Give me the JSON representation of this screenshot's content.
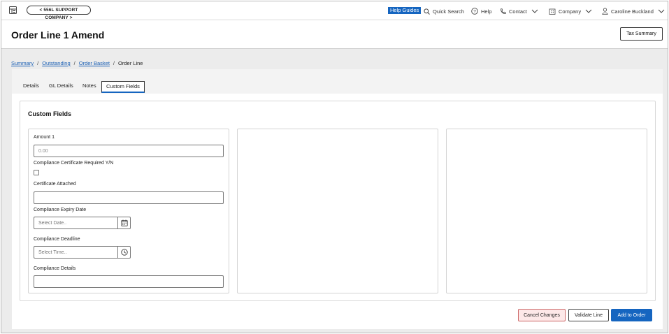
{
  "topbar": {
    "company_label": "< 556L SUPPORT COMPANY >",
    "help_guides": "Help Guides",
    "quick_search": "Quick Search",
    "help": "Help",
    "contact": "Contact",
    "company": "Company",
    "user": "Caroline Buckland"
  },
  "header": {
    "title": "Order Line 1 Amend",
    "tax_summary": "Tax Summary"
  },
  "breadcrumb": {
    "items": [
      "Summary",
      "Outstanding",
      "Order Basket"
    ],
    "current": "Order Line",
    "separator": "/"
  },
  "tabs": [
    "Details",
    "GL Details",
    "Notes",
    "Custom Fields"
  ],
  "active_tab": "Custom Fields",
  "custom_fields": {
    "title": "Custom Fields",
    "amount1_label": "Amount 1",
    "amount1_value": "0.00",
    "cert_required_label": "Compliance Certificate Required Y/N",
    "cert_attached_label": "Certificate Attached",
    "expiry_label": "Compliance Expiry Date",
    "expiry_placeholder": "Select Date..",
    "deadline_label": "Compliance Deadline",
    "deadline_placeholder": "Select Time..",
    "details_label": "Compliance Details"
  },
  "footer": {
    "cancel": "Cancel Changes",
    "validate": "Validate Line",
    "add": "Add to Order"
  },
  "icons": {
    "app": "app-grid-icon",
    "search": "search-icon",
    "help": "question-circle-icon",
    "contact": "phone-icon",
    "company": "building-icon",
    "user": "user-icon",
    "calendar": "calendar-icon",
    "clock": "clock-icon"
  },
  "colors": {
    "accent": "#1565c0",
    "link": "#1a5fb4",
    "cancel_bg": "#fde8e8"
  }
}
